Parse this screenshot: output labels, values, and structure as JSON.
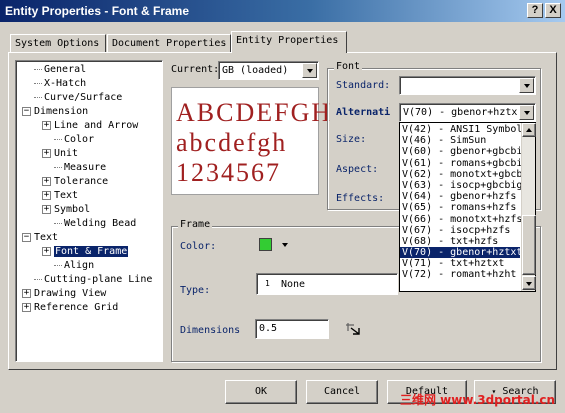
{
  "window": {
    "title": "Entity Properties - Font & Frame",
    "help_btn": "?",
    "close_btn": "X"
  },
  "tabs": [
    {
      "label": "System Options"
    },
    {
      "label": "Document Properties"
    },
    {
      "label": "Entity Properties"
    }
  ],
  "tree": {
    "items": [
      {
        "label": "General"
      },
      {
        "label": "X-Hatch"
      },
      {
        "label": "Curve/Surface"
      },
      {
        "label": "Dimension"
      },
      {
        "label": "Line and Arrow"
      },
      {
        "label": "Color"
      },
      {
        "label": "Unit"
      },
      {
        "label": "Measure"
      },
      {
        "label": "Tolerance"
      },
      {
        "label": "Text"
      },
      {
        "label": "Symbol"
      },
      {
        "label": "Welding Bead"
      },
      {
        "label": "Text"
      },
      {
        "label": "Font & Frame"
      },
      {
        "label": "Align"
      },
      {
        "label": "Cutting-plane Line"
      },
      {
        "label": "Drawing View"
      },
      {
        "label": "Reference Grid"
      }
    ]
  },
  "current": {
    "label": "Current:",
    "value": "GB (loaded)"
  },
  "preview": {
    "line1": "ABCDEFGH",
    "line2": "abcdefgh",
    "line3": "1234567"
  },
  "font_group": {
    "title": "Font",
    "standard_label": "Standard:",
    "standard_value": "",
    "alternative_label": "Alternati",
    "alternative_value": "V(70) - gbenor+hztx",
    "size_label": "Size:",
    "aspect_label": "Aspect:",
    "effects_label": "Effects:",
    "options": [
      {
        "label": "V(42) - ANSI1 Symbol"
      },
      {
        "label": "V(46) - SimSun"
      },
      {
        "label": "V(60) - gbenor+gbcbi"
      },
      {
        "label": "V(61) - romans+gbcbi"
      },
      {
        "label": "V(62) - monotxt+gbcb"
      },
      {
        "label": "V(63) - isocp+gbcbig"
      },
      {
        "label": "V(64) - gbenor+hzfs"
      },
      {
        "label": "V(65) - romans+hzfs"
      },
      {
        "label": "V(66) - monotxt+hzfs"
      },
      {
        "label": "V(67) - isocp+hzfs"
      },
      {
        "label": "V(68) - txt+hzfs"
      },
      {
        "label": "V(70) - gbenor+hztxt"
      },
      {
        "label": "V(71) - txt+hztxt"
      },
      {
        "label": "V(72) - romant+hzht"
      }
    ],
    "selected_index": 11
  },
  "frame_group": {
    "title": "Frame",
    "color_label": "Color:",
    "color_value": "#33cc33",
    "type_label": "Type:",
    "type_number": "1",
    "type_value": "None",
    "dimensions_label": "Dimensions",
    "dimensions_value": "0.5"
  },
  "buttons": {
    "ok": "OK",
    "cancel": "Cancel",
    "default": "Default",
    "search": "Search"
  },
  "watermark": {
    "text": "三维网 www.3dportal.cn"
  },
  "colors": {
    "title_start": "#0a246a",
    "title_end": "#a6caf0",
    "selection": "#0a246a",
    "preview_text": "#a02020",
    "frame_color": "#33cc33"
  }
}
